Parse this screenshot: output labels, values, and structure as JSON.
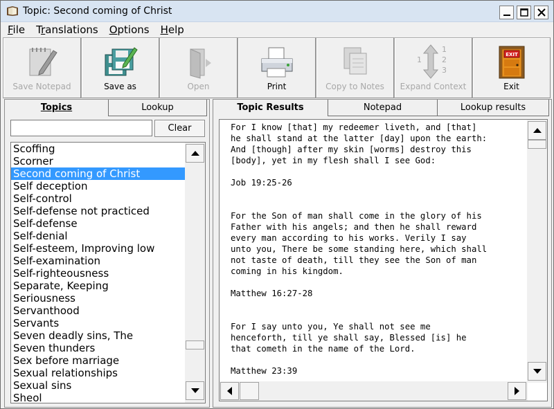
{
  "window": {
    "title": "Topic: Second coming of Christ"
  },
  "menu": [
    {
      "label_pre": "",
      "label_u": "F",
      "label_post": "ile"
    },
    {
      "label_pre": "T",
      "label_u": "r",
      "label_post": "anslations"
    },
    {
      "label_pre": "",
      "label_u": "O",
      "label_post": "ptions"
    },
    {
      "label_pre": "",
      "label_u": "H",
      "label_post": "elp"
    }
  ],
  "toolbar": [
    {
      "label": "Save Notepad",
      "icon": "notepad-pencil-icon",
      "enabled": false
    },
    {
      "label": "Save as",
      "icon": "floppy-disks-icon",
      "enabled": true
    },
    {
      "label": "Open",
      "icon": "open-folder-icon",
      "enabled": false
    },
    {
      "label": "Print",
      "icon": "printer-icon",
      "enabled": true
    },
    {
      "label": "Copy to Notes",
      "icon": "copy-pages-icon",
      "enabled": false
    },
    {
      "label": "Expand Context",
      "icon": "expand-arrows-icon",
      "enabled": false
    },
    {
      "label": "Exit",
      "icon": "exit-door-icon",
      "enabled": true
    }
  ],
  "left_tabs": {
    "topics": "Topics",
    "lookup": "Lookup"
  },
  "search": {
    "value": "",
    "clear_label": "Clear"
  },
  "topics": [
    "Scoffing",
    "Scorner",
    "Second coming of Christ",
    "Self deception",
    "Self-control",
    "Self-defense not practiced",
    "Self-defense",
    "Self-denial",
    "Self-esteem, Improving low",
    "Self-examination",
    "Self-righteousness",
    "Separate, Keeping",
    "Seriousness",
    "Servanthood",
    "Servants",
    "Seven deadly sins, The",
    "Seven thunders",
    "Sex before marriage",
    "Sexual relationships",
    "Sexual sins",
    "Sheol"
  ],
  "selected_topic": "Second coming of Christ",
  "right_tabs": {
    "results": "Topic Results",
    "notepad": "Notepad",
    "lookup_results": "Lookup results"
  },
  "results_text": "For I know [that] my redeemer liveth, and [that]\nhe shall stand at the latter [day] upon the earth:\nAnd [though] after my skin [worms] destroy this\n[body], yet in my flesh shall I see God:\n\nJob 19:25-26\n\n\nFor the Son of man shall come in the glory of his\nFather with his angels; and then he shall reward\nevery man according to his works. Verily I say\nunto you, There be some standing here, which shall\nnot taste of death, till they see the Son of man\ncoming in his kingdom.\n\nMatthew 16:27-28\n\n\nFor I say unto you, Ye shall not see me\nhenceforth, till ye shall say, Blessed [is] he\nthat cometh in the name of the Lord.\n\nMatthew 23:39"
}
